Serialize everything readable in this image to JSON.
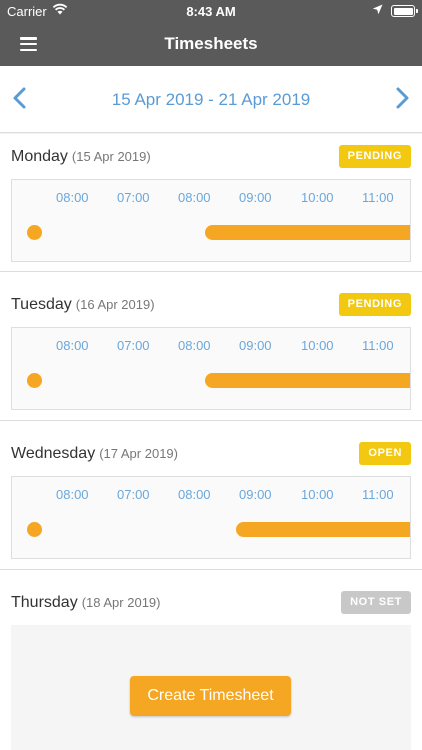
{
  "status_bar": {
    "carrier": "Carrier",
    "time": "8:43 AM"
  },
  "nav": {
    "title": "Timesheets",
    "menu_icon": "hamburger-menu-icon"
  },
  "week": {
    "range": "15 Apr 2019 - 21 Apr 2019",
    "prev_icon": "chevron-left-icon",
    "next_icon": "chevron-right-icon"
  },
  "colors": {
    "accent": "#f5a623",
    "link": "#5b9bd5",
    "pending": "#f2c811",
    "open": "#f2c811",
    "not_set": "#c8c8c8",
    "bar": "#5a5a5a"
  },
  "days": [
    {
      "name": "Monday",
      "date": "(15 Apr 2019)",
      "status": "PENDING",
      "ticks": [
        "08:00",
        "07:00",
        "08:00",
        "09:00",
        "10:00",
        "11:00"
      ]
    },
    {
      "name": "Tuesday",
      "date": "(16 Apr 2019)",
      "status": "PENDING",
      "ticks": [
        "08:00",
        "07:00",
        "08:00",
        "09:00",
        "10:00",
        "11:00"
      ]
    },
    {
      "name": "Wednesday",
      "date": "(17 Apr 2019)",
      "status": "OPEN",
      "ticks": [
        "08:00",
        "07:00",
        "08:00",
        "09:00",
        "10:00",
        "11:00"
      ]
    },
    {
      "name": "Thursday",
      "date": "(18 Apr 2019)",
      "status": "NOT SET",
      "action": "Create Timesheet"
    }
  ]
}
